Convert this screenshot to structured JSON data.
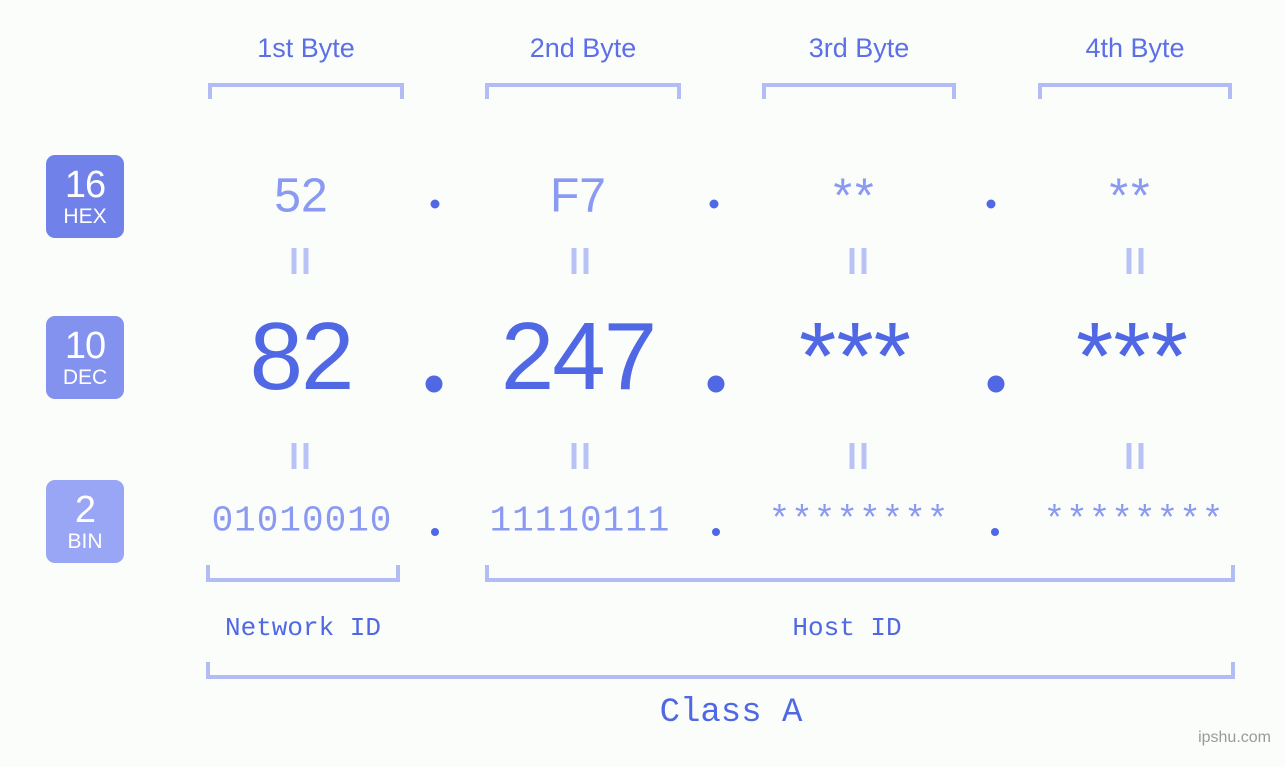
{
  "background_color": "#fbfdfa",
  "accent_colors": {
    "strong_blue": "#5068e4",
    "mid_blue": "#8a99f2",
    "light_blue": "#b3bcf5",
    "badge_hex": "#7081ea",
    "badge_dec": "#8391ef",
    "badge_bin": "#99a5f5",
    "watermark_gray": "#9a9a9a"
  },
  "byte_headers": [
    {
      "label": "1st Byte"
    },
    {
      "label": "2nd Byte"
    },
    {
      "label": "3rd Byte"
    },
    {
      "label": "4th Byte"
    }
  ],
  "bases": [
    {
      "num": "16",
      "name": "HEX"
    },
    {
      "num": "10",
      "name": "DEC"
    },
    {
      "num": "2",
      "name": "BIN"
    }
  ],
  "rows": {
    "hex": {
      "values": [
        "52",
        "F7",
        "**",
        "**"
      ],
      "separator": "."
    },
    "dec": {
      "values": [
        "82",
        "247",
        "***",
        "***"
      ],
      "separator": "."
    },
    "bin": {
      "values": [
        "01010010",
        "11110111",
        "********",
        "********"
      ],
      "separator": "."
    }
  },
  "equality_marks": {
    "glyph": "||",
    "count_per_row": 4,
    "rows": 2
  },
  "segments": [
    {
      "label": "Network ID"
    },
    {
      "label": "Host ID"
    }
  ],
  "class_label": "Class A",
  "watermark": "ipshu.com"
}
